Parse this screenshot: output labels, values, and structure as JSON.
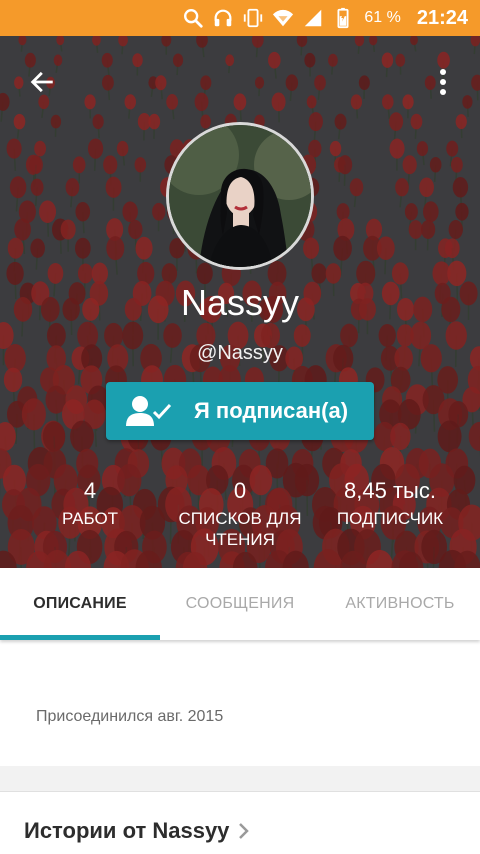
{
  "status_bar": {
    "battery_percent": "61 %",
    "time": "21:24",
    "icons": [
      "search-icon",
      "headphones-icon",
      "vibrate-icon",
      "wifi-icon",
      "signal-icon",
      "battery-icon"
    ]
  },
  "header": {
    "back_icon": "back-arrow-icon",
    "more_icon": "more-vert-icon",
    "display_name": "Nassyy",
    "username": "@Nassyy",
    "follow_button": {
      "icon": "person-check-icon",
      "label": "Я подписан(а)"
    }
  },
  "stats": [
    {
      "value": "4",
      "label": "РАБОТ"
    },
    {
      "value": "0",
      "label": "СПИСКОВ ДЛЯ ЧТЕНИЯ"
    },
    {
      "value": "8,45 тыс.",
      "label": "ПОДПИСЧИК"
    }
  ],
  "tabs": [
    {
      "label": "ОПИСАНИЕ",
      "active": true
    },
    {
      "label": "СООБЩЕНИЯ",
      "active": false
    },
    {
      "label": "АКТИВНОСТЬ",
      "active": false
    }
  ],
  "about": {
    "joined": "Присоединился авг. 2015"
  },
  "stories": {
    "title": "Истории от Nassyy",
    "chevron_icon": "chevron-right-icon"
  },
  "colors": {
    "status_bar": "#f59a2a",
    "accent": "#1ba0b0"
  }
}
